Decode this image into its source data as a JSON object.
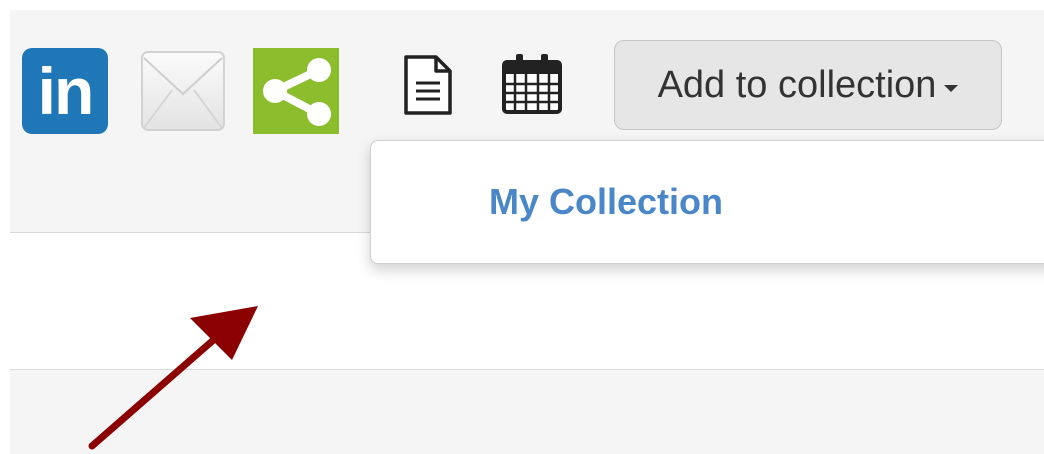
{
  "toolbar": {
    "icons": [
      {
        "name": "linkedin-icon",
        "glyph": "in"
      },
      {
        "name": "email-icon"
      },
      {
        "name": "share-icon"
      },
      {
        "name": "document-icon"
      },
      {
        "name": "calendar-icon"
      }
    ],
    "add_to_collection_label": "Add to collection"
  },
  "dropdown": {
    "items": [
      {
        "label": "My Collection"
      }
    ]
  },
  "colors": {
    "linkedin": "#1f77b8",
    "share": "#8bbd2d",
    "link": "#4a87c8",
    "arrow": "#8b0000",
    "button_bg": "#e6e6e6"
  }
}
